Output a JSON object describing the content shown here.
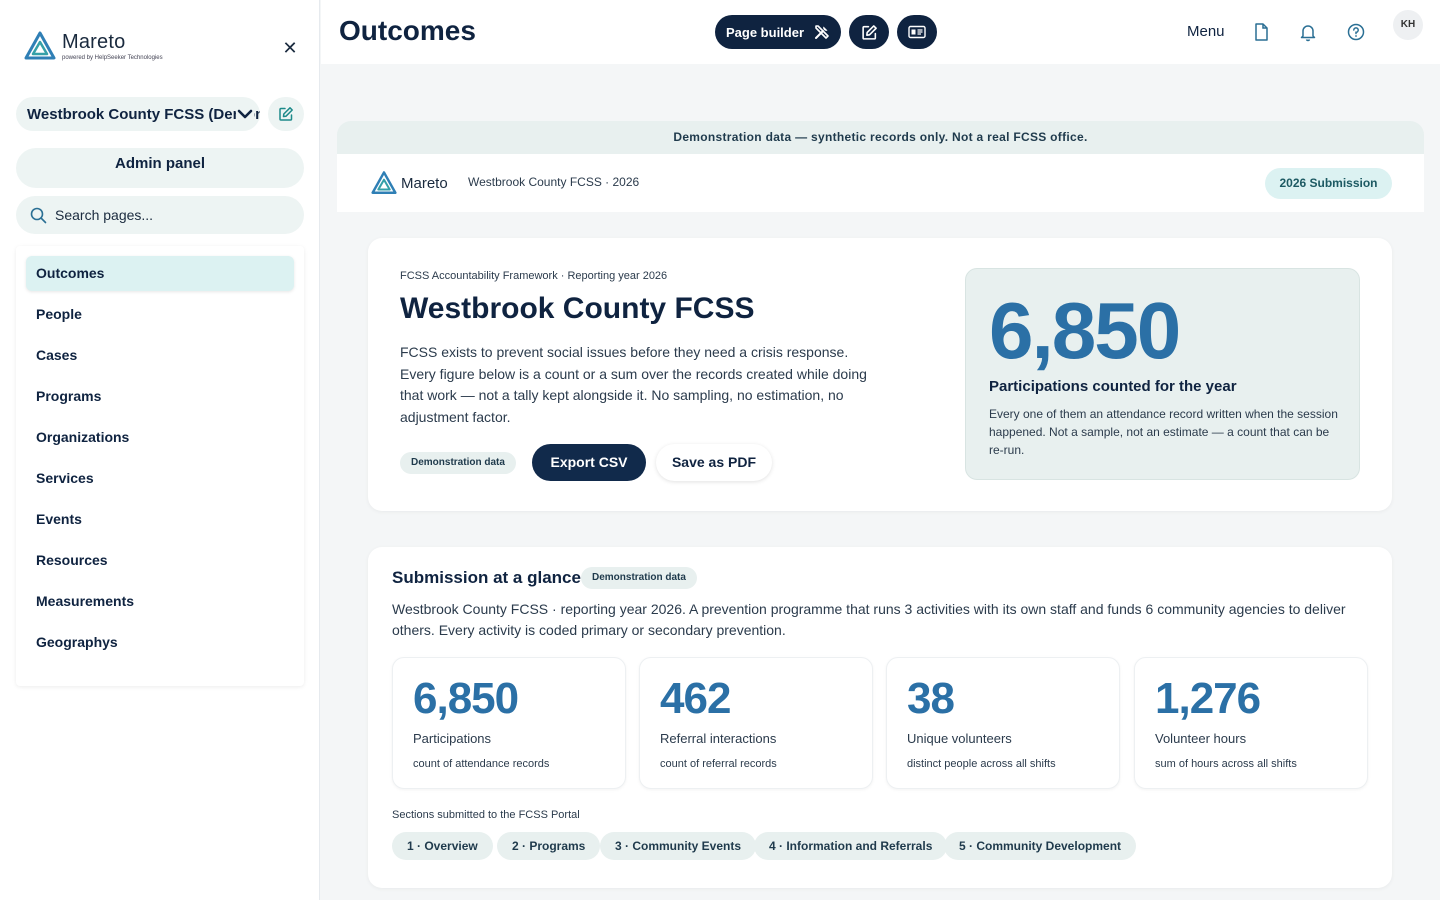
{
  "sidebar": {
    "logo_name": "Mareto",
    "logo_sub": "powered by HelpSeeker Technologies",
    "close_glyph": "✕",
    "org_name": "Westbrook County FCSS (Demonstration)",
    "admin_label": "Admin panel",
    "search_placeholder": "Search pages...",
    "nav": [
      "Outcomes",
      "People",
      "Cases",
      "Programs",
      "Organizations",
      "Services",
      "Events",
      "Resources",
      "Measurements",
      "Geographys"
    ],
    "active_nav": "Outcomes"
  },
  "header": {
    "title": "Outcomes",
    "page_builder_label": "Page builder",
    "menu_label": "Menu",
    "avatar_initials": "KH",
    "icons": [
      "tools-icon",
      "edit-icon",
      "id-card-icon",
      "document-icon",
      "bell-icon",
      "help-icon"
    ]
  },
  "report": {
    "demo_banner": "Demonstration data — synthetic records only. Not a real FCSS office.",
    "brand_name": "Mareto",
    "brand_org": "Westbrook County FCSS · 2026",
    "submission_label": "2026 Submission",
    "hero": {
      "kicker": "FCSS Accountability Framework · Reporting year 2026",
      "title": "Westbrook County FCSS",
      "description": "FCSS exists to prevent social issues before they need a crisis response. Every figure below is a count or a sum over the records created while doing that work — not a tally kept alongside it. No sampling, no estimation, no adjustment factor.",
      "demo_label": "Demonstration data",
      "export_label": "Export CSV",
      "pdf_label": "Save as PDF",
      "stat_value": "6,850",
      "stat_label": "Participations counted for the year",
      "stat_desc": "Every one of them an attendance record written when the session happened. Not a sample, not an estimate — a count that can be re-run."
    },
    "glance": {
      "title": "Submission at a glance",
      "demo_label": "Demonstration data",
      "description": "Westbrook County FCSS · reporting year 2026. A prevention programme that runs 3 activities with its own staff and funds 6 community agencies to deliver others. Every activity is coded primary or secondary prevention.",
      "stats": [
        {
          "value": "6,850",
          "label": "Participations",
          "desc": "count of attendance records"
        },
        {
          "value": "462",
          "label": "Referral interactions",
          "desc": "count of referral records"
        },
        {
          "value": "38",
          "label": "Unique volunteers",
          "desc": "distinct people across all shifts"
        },
        {
          "value": "1,276",
          "label": "Volunteer hours",
          "desc": "sum of hours across all shifts"
        }
      ],
      "sections_label": "Sections submitted to the FCSS Portal",
      "sections": [
        "1 · Overview",
        "2 · Programs",
        "3 · Community Events",
        "4 · Information and Referrals",
        "5 · Community Development"
      ]
    }
  },
  "colors": {
    "navy": "#0f2340",
    "accent_blue": "#2b70a6",
    "mint": "#dcf2f2",
    "pale_green": "#e8f0ef"
  }
}
